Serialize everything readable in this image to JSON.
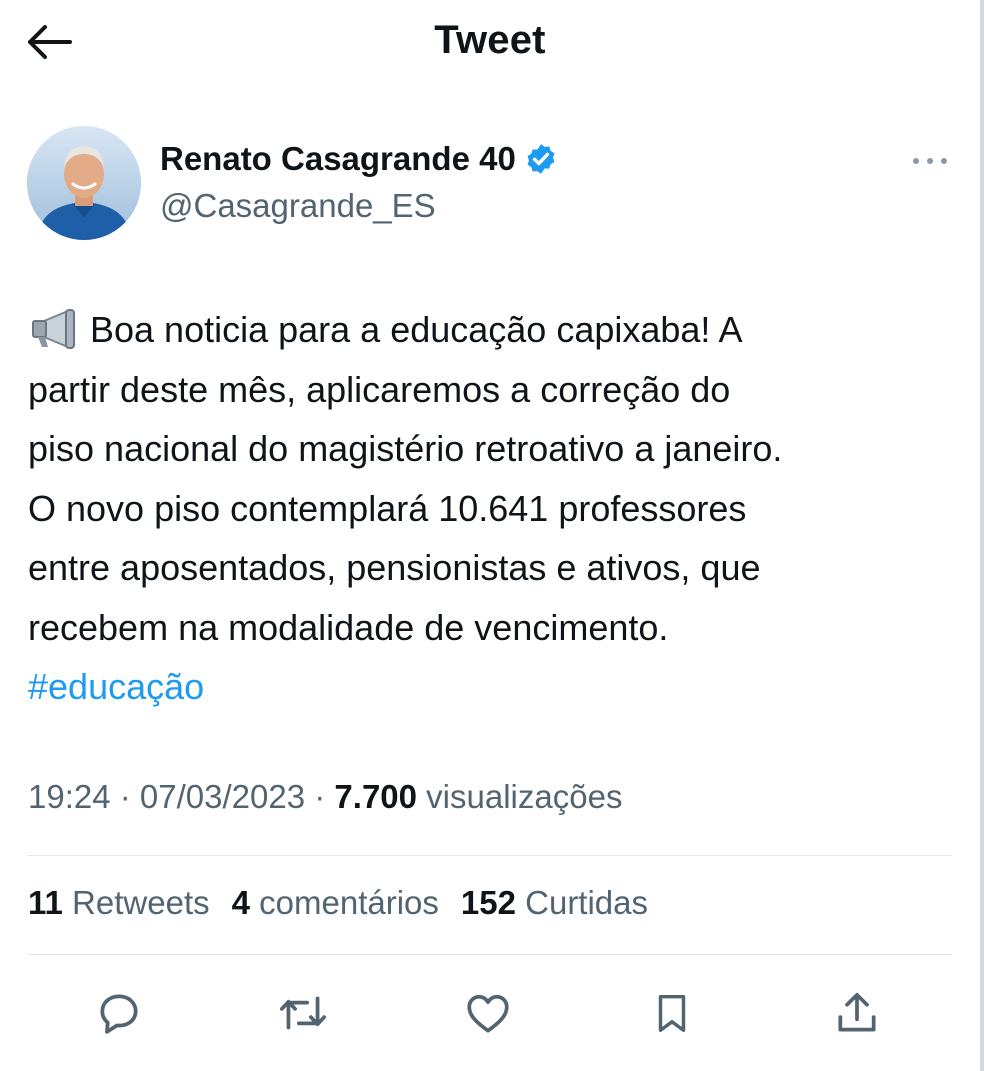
{
  "header": {
    "title": "Tweet",
    "back_icon": "arrow-left-icon"
  },
  "author": {
    "name": "Renato Casagrande 40",
    "handle": "@Casagrande_ES",
    "verified_icon": "verified-badge-icon",
    "verified_color": "#1d9bf0",
    "more_icon": "more-dots-icon"
  },
  "tweet": {
    "emoji": "📢",
    "lines": [
      "Boa noticia para a educação capixaba! A",
      "partir deste mês, aplicaremos a correção do",
      "piso nacional do magistério retroativo a janeiro.",
      "O novo piso contemplará 10.641 professores",
      "entre aposentados, pensionistas e ativos, que",
      "recebem na modalidade de vencimento."
    ],
    "hashtag": "#educação",
    "hashtag_color": "#1d9bf0"
  },
  "meta": {
    "time": "19:24",
    "sep1": " · ",
    "date": "07/03/2023",
    "sep2": " · ",
    "views_count": "7.700",
    "views_label": " visualizações"
  },
  "stats": {
    "retweets_count": "11",
    "retweets_label": " Retweets",
    "comments_count": "4",
    "comments_label": " comentários",
    "likes_count": "152",
    "likes_label": " Curtidas"
  },
  "actions": [
    "reply-icon",
    "retweet-icon",
    "like-icon",
    "bookmark-icon",
    "share-icon"
  ],
  "colors": {
    "text": "#0f1419",
    "secondary": "#536471",
    "accent": "#1d9bf0",
    "divider": "#e1e6ea"
  }
}
